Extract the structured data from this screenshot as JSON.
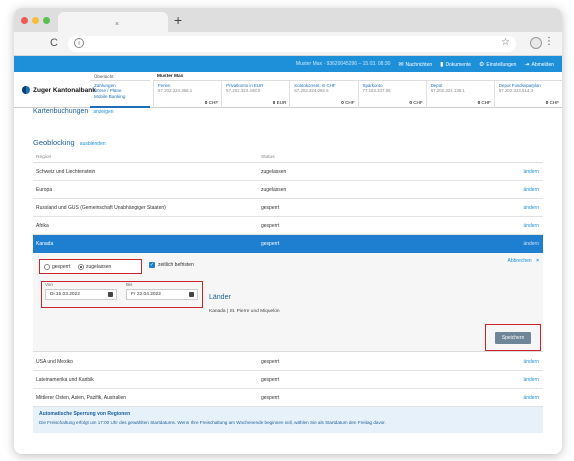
{
  "browser": {
    "tab_close": "×",
    "new_tab": "+",
    "reload_icon": "C",
    "info_icon": "i",
    "star_icon": "☆",
    "menu_icon": "⋮"
  },
  "topbar": {
    "user_info": "Muster Max · 93620045296 – 15.03. 08:30",
    "messages": "Nachrichten",
    "documents": "Dokumente",
    "settings": "Einstellungen",
    "logout": "Abmelden"
  },
  "header": {
    "logo_text": "Zuger Kantonalbank",
    "menu_top": "Übersicht",
    "menu_sub": [
      "Zahlungen",
      "Börse / Pläne",
      "Mobile Banking"
    ],
    "user_name": "Muster Max",
    "tiles": [
      {
        "name": "Ferien",
        "iban": "57.202.324.366.1",
        "amount": "0",
        "currency": "CHF"
      },
      {
        "name": "Privatkonto in EUR",
        "iban": "57.202.324.448.0",
        "amount": "0",
        "currency": "EUR"
      },
      {
        "name": "Kontokorrent. in CHF",
        "iban": "57.202.324.094.5",
        "amount": "0",
        "currency": "CHF"
      },
      {
        "name": "Sparkonto",
        "iban": "77.153.347.06",
        "amount": "0",
        "currency": "CHF"
      },
      {
        "name": "Depot",
        "iban": "57.202.324.135.1",
        "amount": "0",
        "currency": "CHF"
      },
      {
        "name": "Depot Fondssparplan",
        "iban": "57.202.324.514.3",
        "amount": "0",
        "currency": "CHF"
      }
    ]
  },
  "card_bookings": {
    "title": "Kartenbuchungen",
    "link": "anzeigen"
  },
  "geoblocking": {
    "title": "Geoblocking",
    "link": "ausblenden",
    "col_region": "Region",
    "col_status": "Status",
    "rows_top": [
      {
        "region": "Schweiz und Liechtenstein",
        "status": "zugelassen",
        "action": "ändern"
      },
      {
        "region": "Europa",
        "status": "zugelassen",
        "action": "ändern"
      },
      {
        "region": "Russland und GUS (Gemeinschaft Unabhängiger Staaten)",
        "status": "gesperrt",
        "action": "ändern"
      },
      {
        "region": "Afrika",
        "status": "gesperrt",
        "action": "ändern"
      },
      {
        "region": "Kanada",
        "status": "gesperrt",
        "action": "ändern"
      }
    ],
    "rows_bottom": [
      {
        "region": "USA und Mexiko",
        "status": "gesperrt",
        "action": "ändern"
      },
      {
        "region": "Lateinamerika und Karibik",
        "status": "gesperrt",
        "action": "ändern"
      },
      {
        "region": "Mittlerer Osten, Asien, Pazifik, Australien",
        "status": "gesperrt",
        "action": "ändern"
      }
    ]
  },
  "edit_panel": {
    "radio_blocked": "gesperrt",
    "radio_allowed": "zugelassen",
    "selected": "zugelassen",
    "time_limited_label": "zeitlich befristen",
    "time_limited_checked": true,
    "abort_label": "Abbrechen",
    "abort_icon": "×",
    "from_label": "Von",
    "from_value": "Di  15.03.2022",
    "to_label": "Bis",
    "to_value": "Fr  22.04.2022",
    "countries_title": "Länder",
    "countries_list": "Kanada  |  St. Pierre und Miquelon",
    "save_label": "Speichern"
  },
  "info": {
    "title": "Automatische Sperrung von Regionen",
    "text": "Die Freischaltung erfolgt um 17:00 Uhr des gewählten Startdatums. Wenn Ihre Freischaltung am Wochenende beginnen soll, wählen Sie als Startdatum den Freitag davor."
  },
  "colors": {
    "brand_blue": "#1e90d9",
    "selected_row": "#1e7fd0",
    "highlight_red": "#c9232c",
    "save_button": "#6f8598"
  }
}
